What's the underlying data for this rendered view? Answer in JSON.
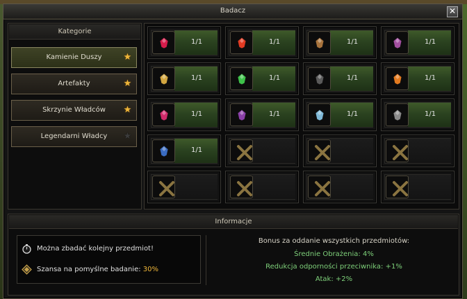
{
  "window": {
    "title": "Badacz",
    "close_glyph": "✕"
  },
  "categories": {
    "header": "Kategorie",
    "items": [
      {
        "label": "Kamienie Duszy",
        "star": "gold",
        "active": true
      },
      {
        "label": "Artefakty",
        "star": "gold",
        "active": false
      },
      {
        "label": "Skrzynie Władców",
        "star": "gold",
        "active": false
      },
      {
        "label": "Legendarni Władcy",
        "star": "dark",
        "active": false
      }
    ]
  },
  "slots": [
    {
      "count": "1/1",
      "gem": "crimson-soulstone-icon",
      "color": "#d61c4b"
    },
    {
      "count": "1/1",
      "gem": "red-soulstone-icon",
      "color": "#e23a22"
    },
    {
      "count": "1/1",
      "gem": "bronze-soulstone-icon",
      "color": "#a8733c"
    },
    {
      "count": "1/1",
      "gem": "violet-soulstone-icon",
      "color": "#a34fa0"
    },
    {
      "count": "1/1",
      "gem": "gold-soulstone-icon",
      "color": "#d2a640"
    },
    {
      "count": "1/1",
      "gem": "green-soulstone-icon",
      "color": "#3ec24a"
    },
    {
      "count": "1/1",
      "gem": "black-soulstone-icon",
      "color": "#5a5a5a"
    },
    {
      "count": "1/1",
      "gem": "orange-soulstone-icon",
      "color": "#e37a1f"
    },
    {
      "count": "1/1",
      "gem": "pink-soulstone-icon",
      "color": "#d02a6a"
    },
    {
      "count": "1/1",
      "gem": "purple-soulstone-icon",
      "color": "#8a3fa8"
    },
    {
      "count": "1/1",
      "gem": "ice-soulstone-icon",
      "color": "#7fb9d8"
    },
    {
      "count": "1/1",
      "gem": "grey-soulstone-icon",
      "color": "#8a8a8a"
    },
    {
      "count": "1/1",
      "gem": "blue-soulstone-icon",
      "color": "#3a6cc2"
    }
  ],
  "empty_slot_count": 7,
  "info": {
    "header": "Informacje",
    "can_research": "Można zbadać kolejny przedmiot!",
    "chance_label": "Szansa na pomyślne badanie: ",
    "chance_value": "30%",
    "bonus_title": "Bonus za oddanie wszystkich przedmiotów:",
    "bonus_lines": [
      "Średnie Obrażenia: 4%",
      "Redukcja odporności przeciwnika: +1%",
      "Atak: +2%"
    ]
  },
  "colors": {
    "accent_gold": "#f0b73a",
    "bonus_green": "#7ed07a",
    "slot_green": "#2b4320"
  }
}
